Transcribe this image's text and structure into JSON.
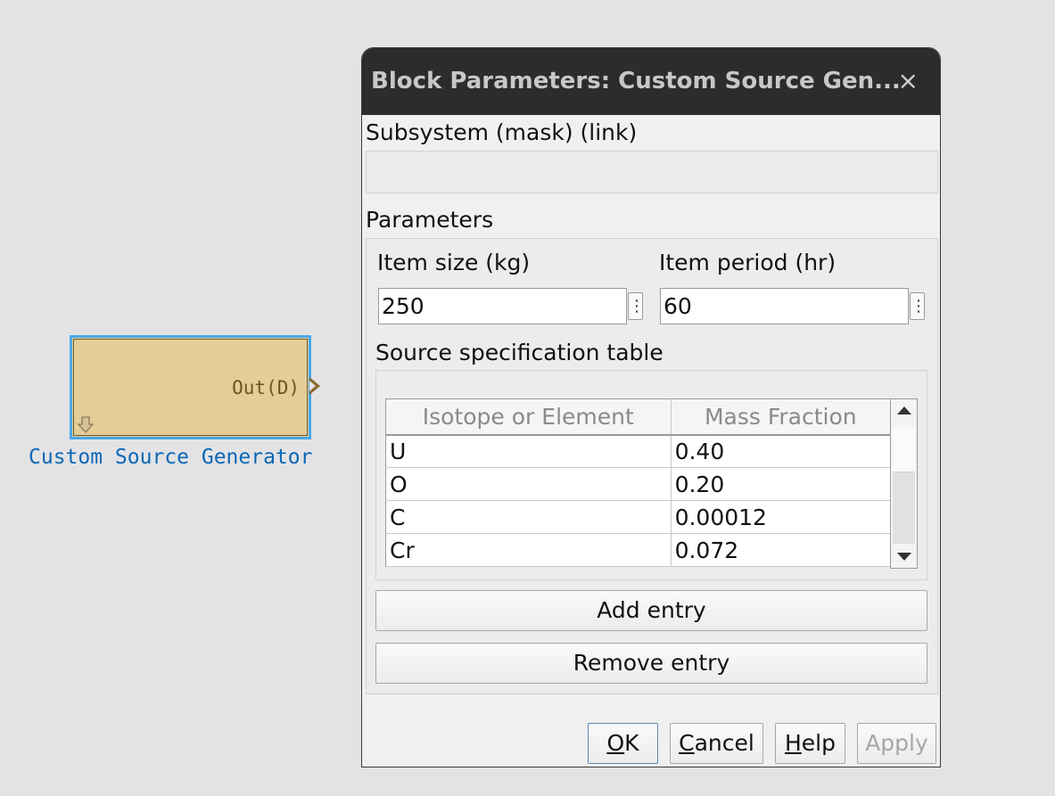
{
  "block": {
    "port_label": "Out(D)",
    "name": "Custom Source Generator"
  },
  "dialog": {
    "title": "Block Parameters: Custom Source Gen...",
    "close_glyph": "×",
    "mask_header": "Subsystem (mask) (link)",
    "parameters_header": "Parameters",
    "item_size": {
      "label": "Item size (kg)",
      "value": "250"
    },
    "item_period": {
      "label": "Item period (hr)",
      "value": "60"
    },
    "table_label": "Source specification table",
    "table": {
      "columns": [
        "Isotope or Element",
        "Mass Fraction"
      ],
      "rows": [
        [
          "U",
          "0.40"
        ],
        [
          "O",
          "0.20"
        ],
        [
          "C",
          "0.00012"
        ],
        [
          "Cr",
          "0.072"
        ]
      ]
    },
    "add_entry": "Add entry",
    "remove_entry": "Remove entry",
    "buttons": {
      "ok": {
        "mnemonic": "O",
        "rest": "K"
      },
      "cancel": {
        "mnemonic": "C",
        "rest": "ancel"
      },
      "help": {
        "mnemonic": "H",
        "rest": "elp"
      },
      "apply": "Apply"
    }
  },
  "colors": {
    "block_fill": "#e4cd97",
    "block_selection": "#4aa8e6",
    "block_name": "#0b67b5",
    "titlebar": "#2c2c2c"
  },
  "icons": [
    "library-link-icon",
    "output-port-arrow-icon",
    "close-icon",
    "kebab-menu-icon",
    "scroll-up-icon",
    "scroll-down-icon"
  ]
}
